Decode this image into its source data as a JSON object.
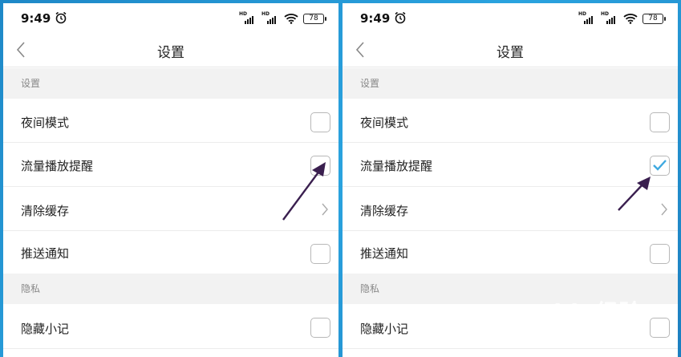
{
  "status_bar": {
    "time": "9:49",
    "battery": "78"
  },
  "nav": {
    "title": "设置"
  },
  "sections": {
    "settings_header": "设置",
    "privacy_header": "隐私"
  },
  "items": {
    "night_mode": "夜间模式",
    "data_playback_alert": "流量播放提醒",
    "clear_cache": "清除缓存",
    "push_notifications": "推送通知",
    "hide_notes": "隐藏小记"
  },
  "state": {
    "left": {
      "night_mode": false,
      "data_playback_alert": false,
      "push_notifications": false,
      "hide_notes": false
    },
    "right": {
      "night_mode": false,
      "data_playback_alert": true,
      "push_notifications": false,
      "hide_notes": false
    }
  },
  "colors": {
    "background": "#2196d3",
    "check_accent": "#3fa9e0",
    "arrow": "#3a1f4f"
  },
  "watermark": {
    "main": "Baidu经验",
    "sub": "jingyan.baidu.com"
  }
}
